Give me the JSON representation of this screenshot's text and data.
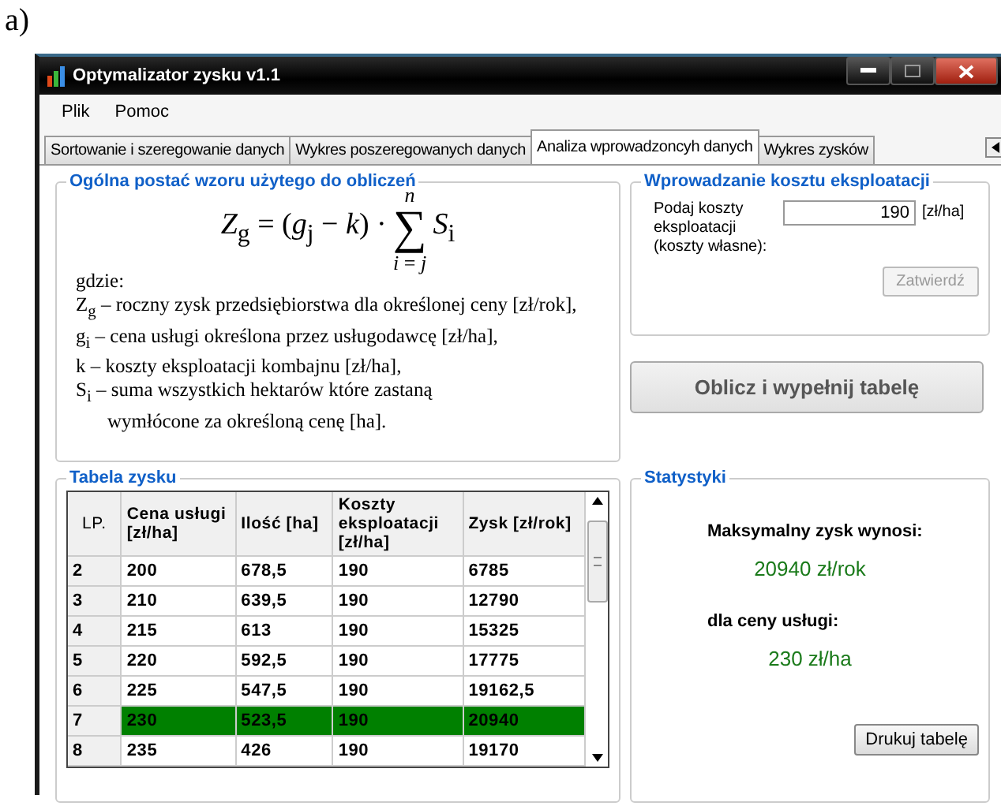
{
  "figure_label": "a)",
  "window": {
    "title": "Optymalizator zysku v1.1"
  },
  "menu": [
    "Plik",
    "Pomoc"
  ],
  "tabs": [
    {
      "label": "Sortowanie i szeregowanie danych",
      "selected": false
    },
    {
      "label": "Wykres poszeregowanych danych",
      "selected": false
    },
    {
      "label": "Analiza wprowadzoncyh danych",
      "selected": true
    },
    {
      "label": "Wykres zysków",
      "selected": false
    }
  ],
  "formula_group": {
    "title": "Ogólna postać wzoru użytego do obliczeń",
    "formula": {
      "left": "*Z*$_{g}$ = (*g*$_{j}$ − *k*) ·",
      "sum_sign": "∑",
      "upper": "*n*",
      "lower": "*i* = *j*",
      "right": "*S*$_{i}$"
    },
    "where": "gdzie:",
    "definitions": [
      "Z$_{g}$ – roczny zysk przedsiębiorstwa dla określonej ceny [zł/rok],",
      "g$_{i}$ – cena usługi określona przez usługodawcę [zł/ha],",
      "k – koszty eksploatacji kombajnu [zł/ha],",
      "S$_{i}$ – suma wszystkich hektarów które zastaną",
      "wymłócone za określoną cenę [ha]."
    ]
  },
  "cost_group": {
    "title": "Wprowadzanie kosztu eksploatacji",
    "label": "Podaj koszty eksploatacji (koszty własne):",
    "value": "190",
    "unit": "[zł/ha]",
    "confirm": {
      "label": "Zatwierdź",
      "disabled": true
    }
  },
  "compute_button": "Oblicz  i wypełnij tabelę",
  "table_group": {
    "title": "Tabela zysku",
    "columns": [
      "LP.",
      "Cena usługi [zł/ha]",
      "Ilość [ha]",
      "Koszty eksploatacji [zł/ha]",
      "Zysk [zł/rok]"
    ],
    "rows": [
      {
        "cells": [
          "2",
          "200",
          "678,5",
          "190",
          "6785"
        ],
        "selected": false
      },
      {
        "cells": [
          "3",
          "210",
          "639,5",
          "190",
          "12790"
        ],
        "selected": false
      },
      {
        "cells": [
          "4",
          "215",
          "613",
          "190",
          "15325"
        ],
        "selected": false
      },
      {
        "cells": [
          "5",
          "220",
          "592,5",
          "190",
          "17775"
        ],
        "selected": false
      },
      {
        "cells": [
          "6",
          "225",
          "547,5",
          "190",
          "19162,5"
        ],
        "selected": false
      },
      {
        "cells": [
          "7",
          "230",
          "523,5",
          "190",
          "20940"
        ],
        "selected": true
      },
      {
        "cells": [
          "8",
          "235",
          "426",
          "190",
          "19170"
        ],
        "selected": false
      }
    ]
  },
  "stats_group": {
    "title": "Statystyki",
    "max_label": "Maksymalny zysk wynosi:",
    "max_value": "20940 zł/rok",
    "price_label": "dla ceny usługi:",
    "price_value": "230 zł/ha",
    "print_button": "Drukuj tabelę"
  }
}
